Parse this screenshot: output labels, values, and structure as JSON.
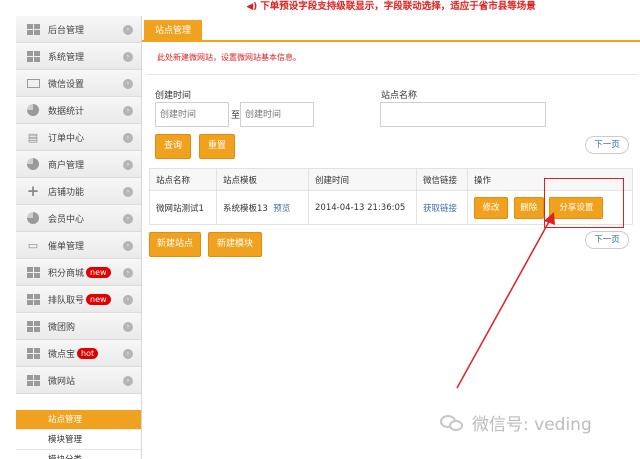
{
  "banner": {
    "icon": "speaker-icon",
    "text": "下单预设字段支持级联显示，字段联动选择，适应于省市县等场景"
  },
  "sidebar": {
    "items": [
      {
        "label": "后台管理",
        "icon": "grid-icon"
      },
      {
        "label": "系统管理",
        "icon": "grid-icon"
      },
      {
        "label": "微信设置",
        "icon": "mail-icon"
      },
      {
        "label": "数据统计",
        "icon": "pie-icon"
      },
      {
        "label": "订单中心",
        "icon": "printer-icon"
      },
      {
        "label": "商户管理",
        "icon": "pie-icon"
      },
      {
        "label": "店铺功能",
        "icon": "plus-icon"
      },
      {
        "label": "会员中心",
        "icon": "pie-icon"
      },
      {
        "label": "催单管理",
        "icon": "folder-icon"
      },
      {
        "label": "积分商城",
        "icon": "grid-icon",
        "badge": "new"
      },
      {
        "label": "排队取号",
        "icon": "grid-icon",
        "badge": "new"
      },
      {
        "label": "微团购",
        "icon": "grid-icon"
      },
      {
        "label": "微点宝",
        "icon": "grid-icon",
        "badge": "hot"
      },
      {
        "label": "微网站",
        "icon": "grid-icon"
      }
    ],
    "sub_items": [
      {
        "label": "站点管理",
        "active": true
      },
      {
        "label": "模块管理",
        "active": false
      },
      {
        "label": "模块分类",
        "active": false
      }
    ]
  },
  "main": {
    "tab": "站点管理",
    "notice": "此处新建微网站，设置微网站基本信息。",
    "filter": {
      "created_label": "创建时间",
      "start_placeholder": "创建时间",
      "to_label": "至",
      "end_placeholder": "创建时间",
      "site_name_label": "站点名称",
      "site_name_value": "",
      "query_btn": "查询",
      "reset_btn": "重置"
    },
    "pager_top": "下一页",
    "pager_bottom": "下一页",
    "table": {
      "headers": [
        "站点名称",
        "站点模板",
        "创建时间",
        "微信链接",
        "操作"
      ],
      "row": {
        "name": "微网站测试1",
        "template": "系统模板13",
        "preview": "预览",
        "created": "2014-04-13 21:36:05",
        "wx_link": "获取链接",
        "edit": "修改",
        "delete": "删除",
        "share": "分享设置"
      }
    },
    "new_site_btn": "新建站点",
    "new_module_btn": "新建模块"
  },
  "colors": {
    "accent": "#f0a21e",
    "alert": "#e02020",
    "link": "#3a6ea5"
  },
  "watermark": {
    "icon": "wechat-icon",
    "text": "微信号: veding"
  }
}
